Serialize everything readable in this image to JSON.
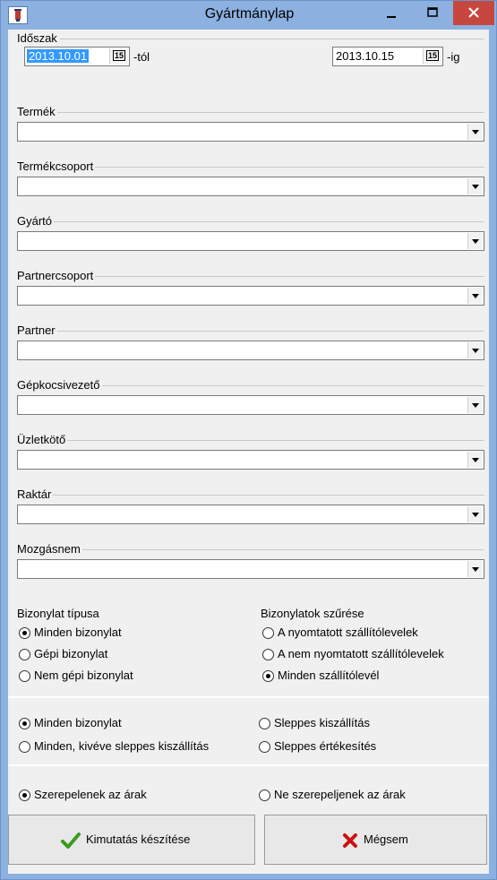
{
  "window": {
    "title": "Gyártmánylap"
  },
  "period": {
    "label": "Időszak",
    "from_value": "2013.10.01",
    "from_suffix": "-tól",
    "to_value": "2013.10.15",
    "to_suffix": "-ig",
    "calendar_glyph": "15"
  },
  "filters": [
    {
      "label": "Termék",
      "value": ""
    },
    {
      "label": "Termékcsoport",
      "value": ""
    },
    {
      "label": "Gyártó",
      "value": ""
    },
    {
      "label": "Partnercsoport",
      "value": ""
    },
    {
      "label": "Partner",
      "value": ""
    },
    {
      "label": "Gépkocsivezető",
      "value": ""
    },
    {
      "label": "Üzletkötő",
      "value": ""
    },
    {
      "label": "Raktár",
      "value": ""
    },
    {
      "label": "Mozgásnem",
      "value": ""
    }
  ],
  "doc_type": {
    "label": "Bizonylat típusa",
    "options": [
      "Minden bizonylat",
      "Gépi bizonylat",
      "Nem gépi bizonylat"
    ],
    "selected": 0
  },
  "doc_filter": {
    "label": "Bizonylatok szűrése",
    "options": [
      "A nyomtatott szállítólevelek",
      "A nem nyomtatott szállítólevelek",
      "Minden szállítólevél"
    ],
    "selected": 2
  },
  "delivery": {
    "options": [
      "Minden bizonylat",
      "Minden, kivéve sleppes kiszállítás",
      "Sleppes kiszállítás",
      "Sleppes értékesítés"
    ],
    "selected": 0
  },
  "prices": {
    "options": [
      "Szerepelenek az árak",
      "Ne szerepeljenek az árak"
    ],
    "selected": 0
  },
  "buttons": {
    "report_label": "Kimutatás készítése",
    "cancel_label": "Mégsem"
  },
  "colors": {
    "titlebar": "#8cb0e0",
    "close_button": "#c7473f",
    "check_green": "#3a9a1e",
    "cancel_red": "#cc1111",
    "selection": "#3399ff"
  }
}
